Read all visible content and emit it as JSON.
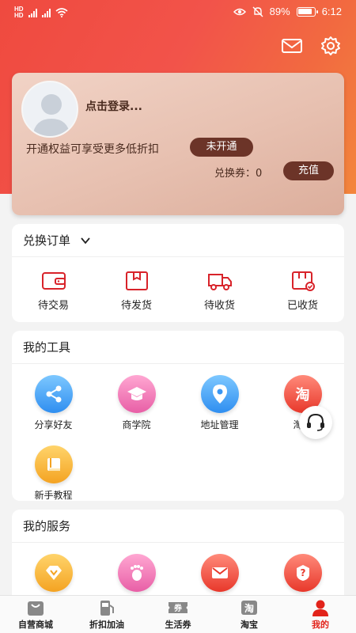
{
  "status_bar": {
    "battery": "89%",
    "time": "6:12"
  },
  "member_card": {
    "login_prompt": "点击登录...",
    "promo": "开通权益可享受更多低折扣",
    "open_button": "未开通",
    "coupon_label": "兑换券：0",
    "recharge_button": "充值"
  },
  "orders": {
    "title": "兑换订单",
    "items": [
      {
        "label": "待交易",
        "icon": "wallet-icon"
      },
      {
        "label": "待发货",
        "icon": "box-icon"
      },
      {
        "label": "待收货",
        "icon": "truck-icon"
      },
      {
        "label": "已收货",
        "icon": "received-box-icon"
      }
    ]
  },
  "tools": {
    "title": "我的工具",
    "items": [
      {
        "label": "分享好友",
        "icon": "share-icon"
      },
      {
        "label": "商学院",
        "icon": "graduation-cap-icon"
      },
      {
        "label": "地址管理",
        "icon": "location-pin-icon"
      },
      {
        "label": "淘宝",
        "icon": "taobao-icon"
      },
      {
        "label": "新手教程",
        "icon": "tutorial-book-icon"
      }
    ]
  },
  "services": {
    "title": "我的服务",
    "items": [
      {
        "icon": "diamond-icon"
      },
      {
        "icon": "footprint-icon"
      },
      {
        "icon": "envelope-icon"
      },
      {
        "icon": "help-icon"
      }
    ]
  },
  "tabbar": {
    "items": [
      {
        "label": "自营商城",
        "icon": "shopping-bag-icon"
      },
      {
        "label": "折扣加油",
        "icon": "fuel-pump-icon"
      },
      {
        "label": "生活券",
        "icon": "ticket-icon",
        "icon_text": "券"
      },
      {
        "label": "淘宝",
        "icon": "taobao-tab-icon",
        "icon_text": "淘"
      },
      {
        "label": "我的",
        "icon": "person-icon"
      }
    ],
    "active_index": 4
  },
  "colors": {
    "accent": "#e2231a",
    "hero": "#ef4a3f",
    "card_dark": "#6c3428"
  }
}
